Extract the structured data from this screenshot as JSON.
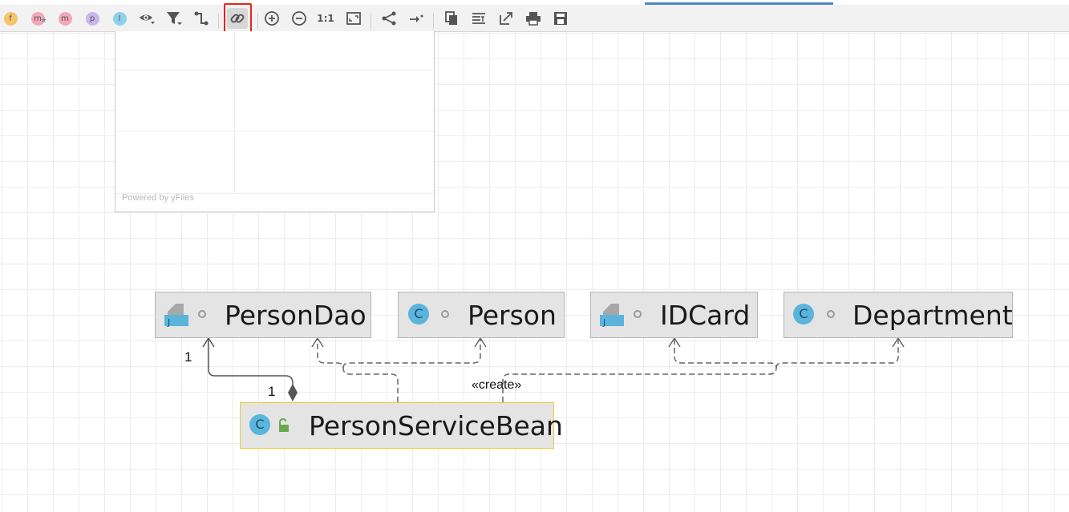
{
  "toolbar": {
    "items": [
      {
        "name": "fields-filter",
        "glyph": "f",
        "color": "#f5c56a"
      },
      {
        "name": "constructors-filter",
        "glyph": "m",
        "color": "#f2a8b8"
      },
      {
        "name": "methods-filter",
        "glyph": "m",
        "color": "#f2a8b8"
      },
      {
        "name": "properties-filter",
        "glyph": "p",
        "color": "#c8b6ec"
      },
      {
        "name": "inner-classes-filter",
        "glyph": "I",
        "color": "#8fd0ea"
      }
    ],
    "zoom_actual_label": "1:1",
    "selected_tool": "show-dependencies"
  },
  "overview": {
    "powered_by": "Powered by yFiles"
  },
  "diagram": {
    "nodes": {
      "person_dao": {
        "name": "PersonDao",
        "kind": "interface"
      },
      "person": {
        "name": "Person",
        "kind": "class",
        "icon_letter": "C"
      },
      "idcard": {
        "name": "IDCard",
        "kind": "interface"
      },
      "department": {
        "name": "Department",
        "kind": "class",
        "icon_letter": "C"
      },
      "person_service_bean": {
        "name": "PersonServiceBean",
        "kind": "class",
        "icon_letter": "C",
        "selected": true
      }
    },
    "edges": {
      "composition": {
        "from": "PersonServiceBean",
        "to": "PersonDao",
        "source_multiplicity": "1",
        "target_multiplicity": "1"
      },
      "create": {
        "stereotype": "«create»"
      }
    }
  },
  "colors": {
    "selection_highlight": "#e8231a",
    "progress_bar": "#4a88c7",
    "class_icon": "#5ab4dc",
    "selected_node_border": "#f0c73a"
  }
}
